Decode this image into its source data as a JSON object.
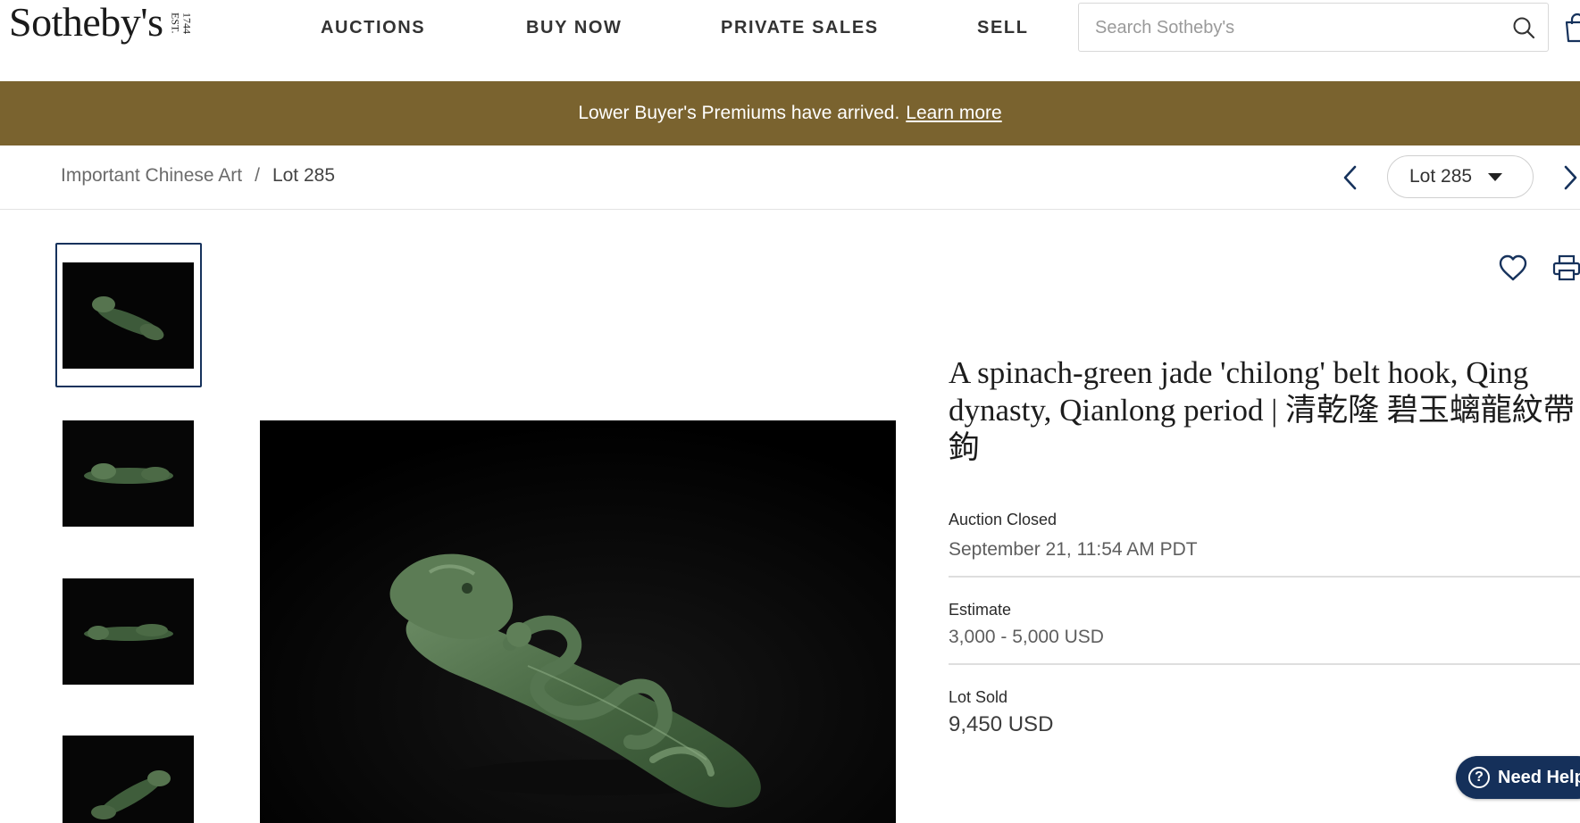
{
  "brand": {
    "name": "Sotheby's",
    "est": [
      "EST.",
      "1744"
    ]
  },
  "nav": {
    "items": [
      {
        "label": "AUCTIONS"
      },
      {
        "label": "BUY NOW"
      },
      {
        "label": "PRIVATE SALES"
      },
      {
        "label": "SELL"
      }
    ]
  },
  "search": {
    "placeholder": "Search Sotheby's",
    "value": ""
  },
  "banner": {
    "text": "Lower Buyer's Premiums have arrived.",
    "link": "Learn more",
    "color": "#7a632f"
  },
  "breadcrumb": {
    "parent": "Important Chinese Art",
    "separator": "/",
    "current": "Lot 285"
  },
  "lot_nav": {
    "selected": "Lot 285"
  },
  "thumbnails": [
    {
      "icon": "jade-belt-hook-thumbnail",
      "selected": true
    },
    {
      "icon": "jade-belt-hook-thumbnail",
      "selected": false
    },
    {
      "icon": "jade-belt-hook-thumbnail",
      "selected": false
    },
    {
      "icon": "jade-belt-hook-thumbnail",
      "selected": false
    }
  ],
  "lot": {
    "title": "A spinach-green jade 'chilong' belt hook, Qing dynasty, Qianlong period | 清乾隆 碧玉螭龍紋帶鉤",
    "status_label": "Auction Closed",
    "status_value": "September 21, 11:54 AM PDT",
    "estimate_label": "Estimate",
    "estimate_value": "3,000 - 5,000 USD",
    "sold_label": "Lot Sold",
    "sold_value": "9,450 USD"
  },
  "help": {
    "label": "Need Help"
  },
  "colors": {
    "accent_navy": "#15305a",
    "banner_gold": "#7a632f",
    "jade_green": "#4d6b47"
  }
}
